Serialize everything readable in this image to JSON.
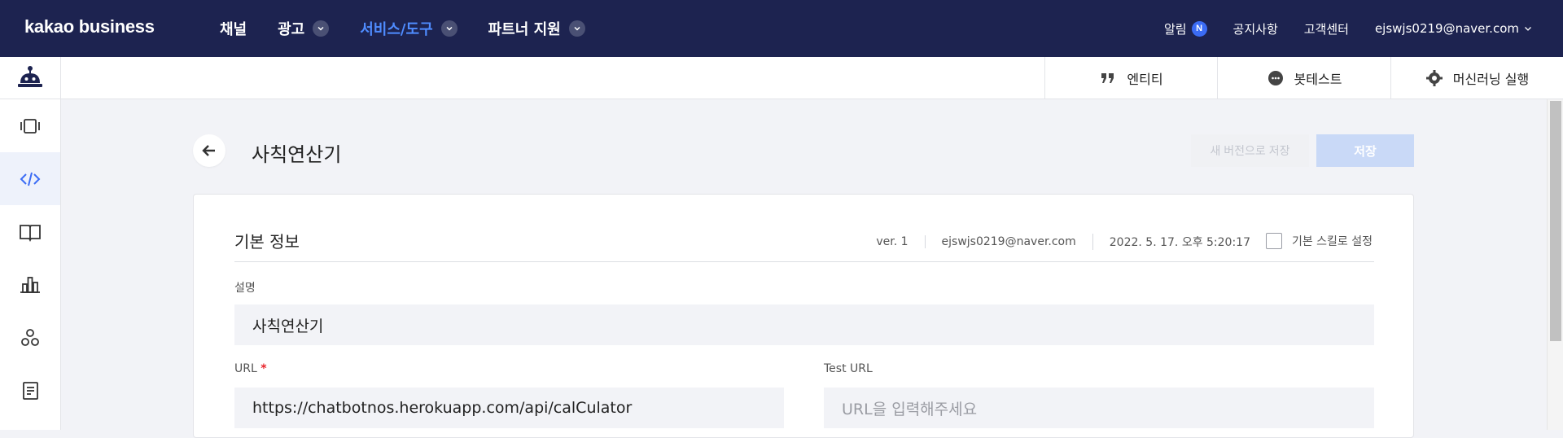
{
  "topnav": {
    "logo": "kakao business",
    "menu": [
      {
        "label": "채널"
      },
      {
        "label": "광고"
      },
      {
        "label": "서비스/도구"
      },
      {
        "label": "파트너 지원"
      }
    ],
    "alarm_label": "알림",
    "alarm_badge": "N",
    "notice_label": "공지사항",
    "support_label": "고객센터",
    "account": "ejswjs0219@naver.com"
  },
  "subbar": {
    "entity_label": "엔티티",
    "bottest_label": "봇테스트",
    "ml_label": "머신러닝 실행"
  },
  "page": {
    "title": "사칙연산기",
    "save_new_version_label": "새 버전으로 저장",
    "save_label": "저장"
  },
  "basic_info": {
    "section_title": "기본 정보",
    "version": "ver. 1",
    "author": "ejswjs0219@naver.com",
    "date": "2022. 5. 17. 오후 5:20:17",
    "default_skill_label": "기본 스킬로 설정",
    "description_label": "설명",
    "description_value": "사칙연산기",
    "url_label": "URL",
    "url_required_mark": "*",
    "url_value": "https://chatbotnos.herokuapp.com/api/calCulator",
    "test_url_label": "Test URL",
    "test_url_placeholder": "URL을 입력해주세요"
  },
  "colors": {
    "nav_bg": "#1d2350",
    "active_menu": "#4f8cff",
    "save_btn": "#c9d9f7",
    "page_bg": "#f2f3f7"
  }
}
